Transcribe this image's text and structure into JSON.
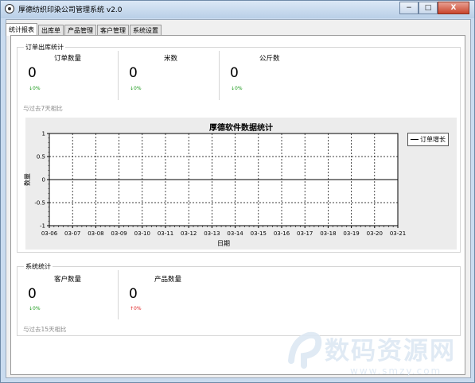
{
  "window": {
    "title": "厚德纺织印染公司管理系统 v2.0",
    "minimize_label": "−",
    "maximize_label": "□",
    "close_label": "X"
  },
  "tabs": [
    {
      "label": "统计报表",
      "active": true
    },
    {
      "label": "出库单",
      "active": false
    },
    {
      "label": "产品管理",
      "active": false
    },
    {
      "label": "客户管理",
      "active": false
    },
    {
      "label": "系统设置",
      "active": false
    }
  ],
  "order_stats": {
    "group_title": "订单出库统计",
    "items": [
      {
        "label": "订单数量",
        "value": "0",
        "change": "↓0%",
        "direction": "down"
      },
      {
        "label": "米数",
        "value": "0",
        "change": "↓0%",
        "direction": "down"
      },
      {
        "label": "公斤数",
        "value": "0",
        "change": "↓0%",
        "direction": "down"
      }
    ],
    "compare_text": "与过去7天相比"
  },
  "chart_data": {
    "type": "line",
    "title": "厚德软件数据统计",
    "xlabel": "日期",
    "ylabel": "数量",
    "categories": [
      "03-06",
      "03-07",
      "03-08",
      "03-09",
      "03-10",
      "03-11",
      "03-12",
      "03-13",
      "03-14",
      "03-15",
      "03-16",
      "03-17",
      "03-18",
      "03-19",
      "03-20",
      "03-21"
    ],
    "series": [
      {
        "name": "订单增长",
        "values": [
          0,
          0,
          0,
          0,
          0,
          0,
          0,
          0,
          0,
          0,
          0,
          0,
          0,
          0,
          0,
          0
        ]
      }
    ],
    "ylim": [
      -1,
      1
    ],
    "yticks": [
      "1",
      "0.5",
      "0",
      "-0.5",
      "-1"
    ],
    "grid": true,
    "legend_position": "right"
  },
  "system_stats": {
    "group_title": "系统统计",
    "items": [
      {
        "label": "客户数量",
        "value": "0",
        "change": "↓0%",
        "direction": "down"
      },
      {
        "label": "产品数量",
        "value": "0",
        "change": "↑0%",
        "direction": "up"
      }
    ],
    "compare_text": "与过去15天相比"
  },
  "watermark": {
    "text": "数码资源网",
    "url": "www.smzy.com"
  },
  "colors": {
    "down": "#1a9a1a",
    "up": "#e02020",
    "titlebar": "#c9dbef"
  }
}
